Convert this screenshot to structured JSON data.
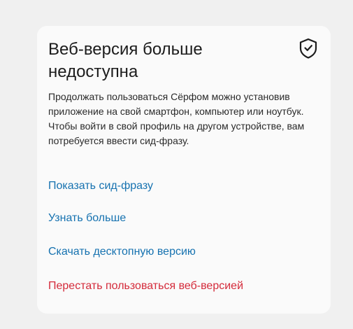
{
  "card": {
    "title": "Веб-версия больше недоступна",
    "shield_icon": "shield-check-icon",
    "description": "Продолжать пользоваться Сёрфом можно установив приложение на свой смартфон, компьютер или ноутбук. Чтобы войти в свой профиль на другом устройстве, вам потребуется ввести сид-фразу.",
    "actions": [
      {
        "label": "Показать сид-фразу",
        "color": "#1672b0"
      },
      {
        "label": "Узнать больше",
        "color": "#1672b0"
      },
      {
        "label": "Скачать десктопную версию",
        "color": "#1672b0"
      },
      {
        "label": "Перестать пользоваться веб-версией",
        "color": "#d42a3a"
      }
    ]
  },
  "colors": {
    "background": "#f0f0f0",
    "card": "#fafafa",
    "link": "#1672b0",
    "danger": "#d42a3a"
  }
}
